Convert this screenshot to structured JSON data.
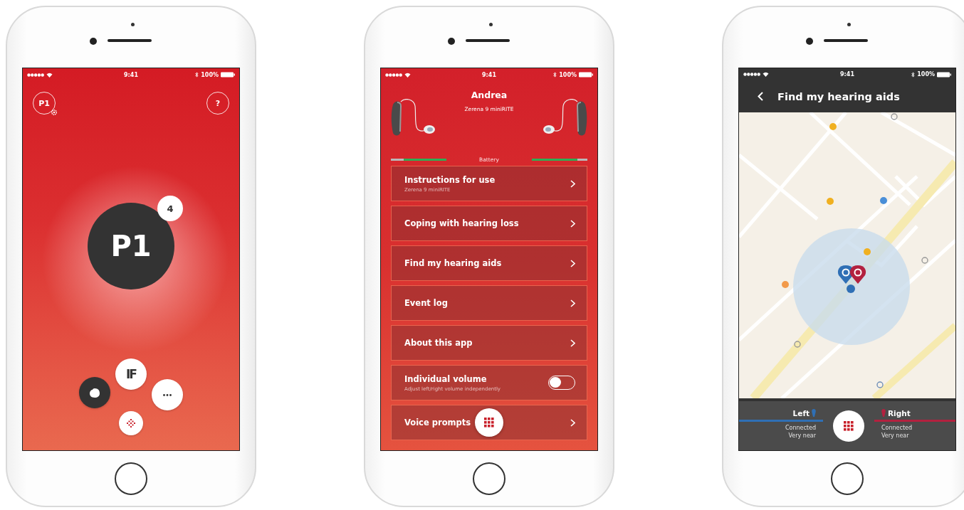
{
  "program_screen": {
    "status_bar": {
      "time": "9:41",
      "battery": "100%"
    },
    "program_button": "P1",
    "help_button": "?",
    "program": {
      "label": "P1",
      "count": "4"
    },
    "actions": [
      {
        "kind": "sound",
        "selected": true
      },
      {
        "kind": "ifttt",
        "label": "IF",
        "selected": false
      },
      {
        "kind": "more",
        "selected": false
      },
      {
        "kind": "remote",
        "selected": false
      }
    ]
  },
  "menu_screen": {
    "status_bar": {
      "time": "9:41",
      "battery": "100%"
    },
    "user_name": "Andrea",
    "device_model": "Zerena 9 miniRITE",
    "battery_label": "Battery",
    "batteries": [
      {
        "level": 0.77
      },
      {
        "level": 0.82
      }
    ],
    "rows": [
      {
        "kind": "link",
        "title": "Instructions for use",
        "subtitle": "Zerena 9 miniRITE"
      },
      {
        "kind": "link",
        "title": "Coping with hearing loss"
      },
      {
        "kind": "link",
        "title": "Find my hearing aids"
      },
      {
        "kind": "link",
        "title": "Event log"
      },
      {
        "kind": "link",
        "title": "About this app"
      },
      {
        "kind": "toggle",
        "title": "Individual volume",
        "subtitle": "Adjust left/right volume independently",
        "on": false
      },
      {
        "kind": "link",
        "title": "Voice prompts"
      }
    ]
  },
  "find_screen": {
    "status_bar": {
      "time": "9:41",
      "battery": "100%"
    },
    "title": "Find my hearing aids",
    "sides": [
      {
        "label": "Left",
        "color": "#2f6fb5",
        "status": "Connected",
        "distance": "Very near"
      },
      {
        "label": "Right",
        "color": "#b3213f",
        "status": "Connected",
        "distance": "Very near"
      }
    ]
  }
}
